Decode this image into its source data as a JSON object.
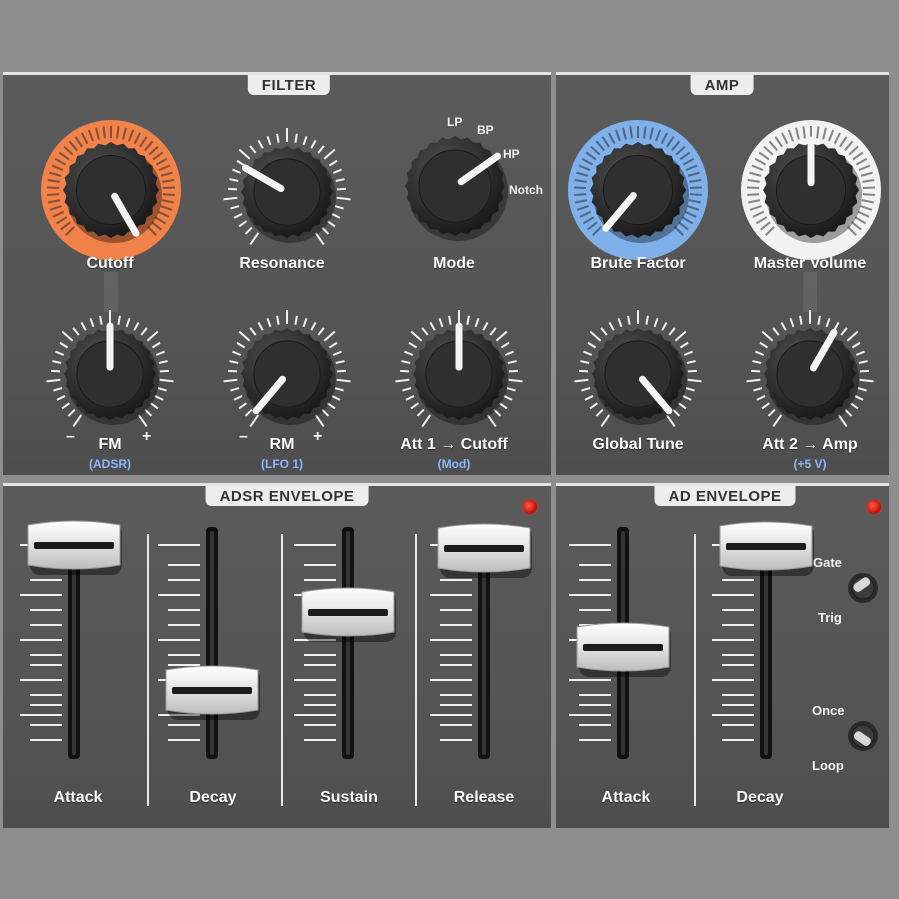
{
  "sections": {
    "filter": "FILTER",
    "amp": "AMP",
    "adsr": "ADSR ENVELOPE",
    "ad": "AD ENVELOPE"
  },
  "colors": {
    "cutoff_ring": "#f0824a",
    "brute_ring": "#7fb0ea",
    "master_ring": "#f2f2f2",
    "sublabel": "#8ab8ff"
  },
  "knobs": {
    "cutoff": {
      "label": "Cutoff"
    },
    "resonance": {
      "label": "Resonance"
    },
    "mode": {
      "label": "Mode",
      "options": [
        "LP",
        "BP",
        "HP",
        "Notch"
      ]
    },
    "brute": {
      "label": "Brute Factor"
    },
    "master": {
      "label": "Master Volume"
    },
    "fm": {
      "label": "FM",
      "sub": "(ADSR)",
      "minus": "–",
      "plus": "+"
    },
    "rm": {
      "label": "RM",
      "sub": "(LFO 1)",
      "minus": "–",
      "plus": "+"
    },
    "att1": {
      "label": "Att 1 → Cutoff",
      "sub": "(Mod)"
    },
    "tune": {
      "label": "Global Tune"
    },
    "att2": {
      "label": "Att 2 → Amp",
      "sub": "(+5 V)"
    }
  },
  "adsr": {
    "attack": "Attack",
    "decay": "Decay",
    "sustain": "Sustain",
    "release": "Release"
  },
  "ad": {
    "attack": "Attack",
    "decay": "Decay",
    "gate": "Gate",
    "trig": "Trig",
    "once": "Once",
    "loop": "Loop"
  }
}
